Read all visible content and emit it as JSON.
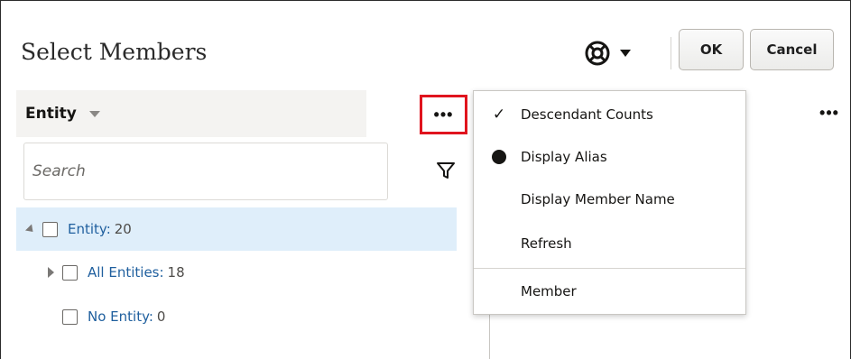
{
  "dialog": {
    "title": "Select Members",
    "ok_label": "OK",
    "cancel_label": "Cancel",
    "help_icon": "lifebuoy-icon"
  },
  "dimension": {
    "label": "Entity"
  },
  "search": {
    "placeholder": "Search",
    "value": ""
  },
  "more_glyph": "•••",
  "tree": [
    {
      "name": "Entity:",
      "count": "20",
      "expanded": true,
      "selected": true
    },
    {
      "name": "All Entities:",
      "count": "18",
      "expanded": false
    },
    {
      "name": "No Entity:",
      "count": "0",
      "leaf": true
    }
  ],
  "menu": {
    "items": [
      {
        "label": "Descendant Counts",
        "mark": "✓"
      },
      {
        "label": "Display Alias",
        "mark": "dot"
      },
      {
        "label": "Display Member Name",
        "mark": ""
      },
      {
        "label": "Refresh",
        "mark": ""
      },
      {
        "label": "Member",
        "mark": ""
      }
    ]
  },
  "colors": {
    "highlight_border": "#e0141e",
    "selected_row": "#dfeefa",
    "link": "#1f5f9e"
  }
}
